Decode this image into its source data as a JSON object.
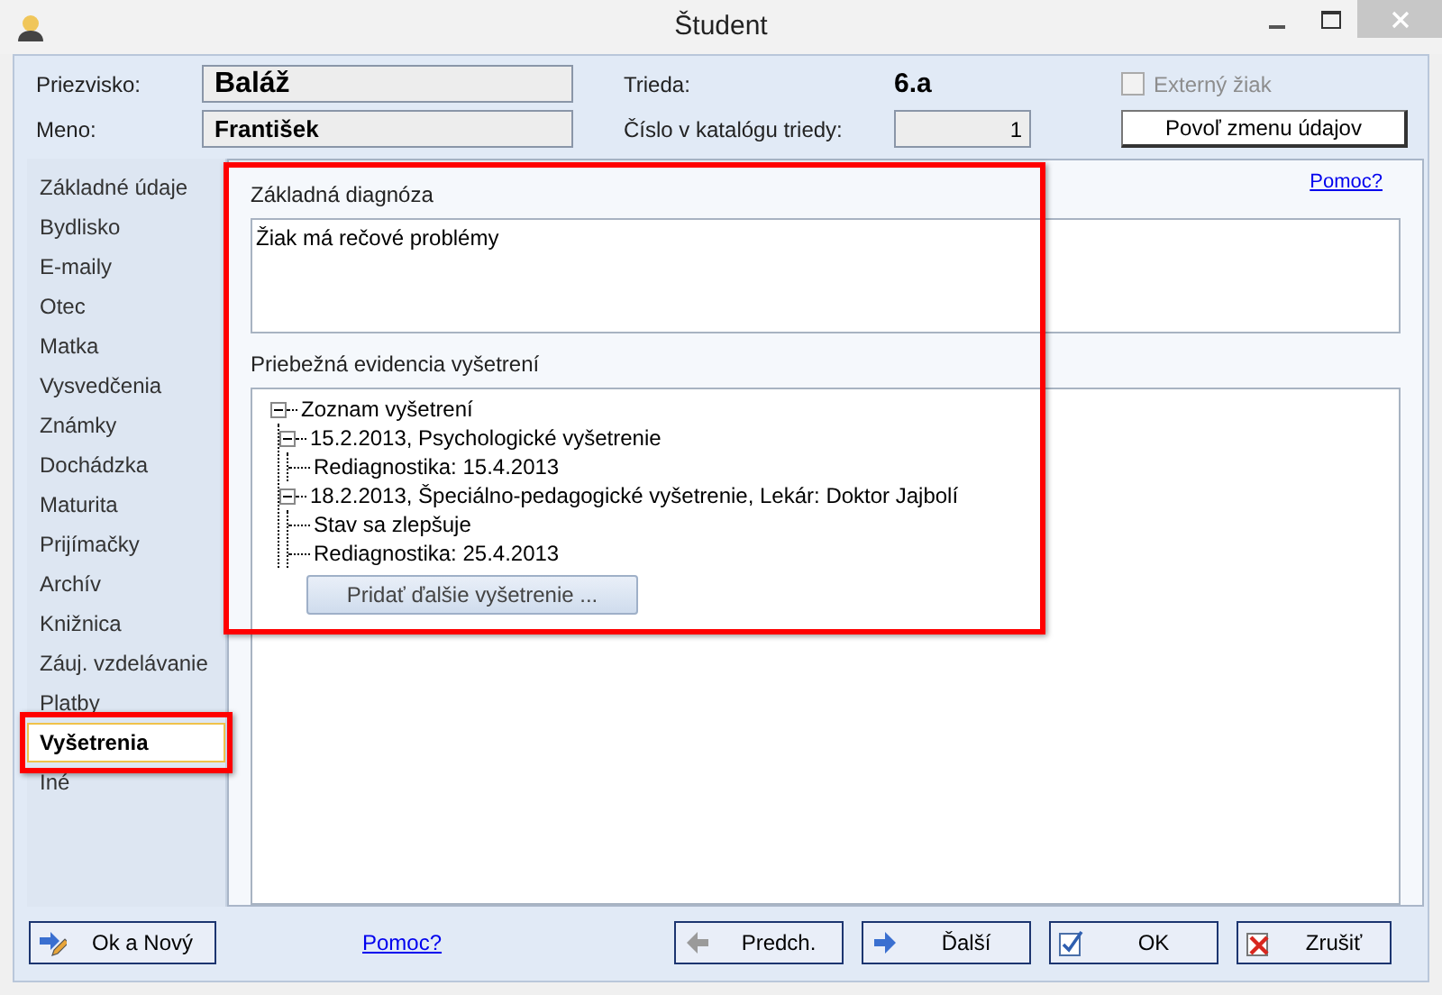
{
  "window": {
    "title": "Študent"
  },
  "header": {
    "fields": [
      {
        "label": "Priezvisko:",
        "value": "Baláž"
      },
      {
        "label": "Meno:",
        "value": "František"
      }
    ],
    "class_info": {
      "label": "Trieda:",
      "value": "6.a"
    },
    "catalog": {
      "label": "Číslo v katalógu triedy:",
      "value": "1"
    },
    "external": {
      "label": "Externý žiak",
      "checked": false,
      "disabled": true
    },
    "unlock_button": "Povoľ zmenu údajov"
  },
  "sidebar": {
    "items": [
      {
        "label": "Základné údaje",
        "selected": false
      },
      {
        "label": "Bydlisko",
        "selected": false
      },
      {
        "label": "E-maily",
        "selected": false
      },
      {
        "label": "Otec",
        "selected": false
      },
      {
        "label": "Matka",
        "selected": false
      },
      {
        "label": "Vysvedčenia",
        "selected": false
      },
      {
        "label": "Známky",
        "selected": false
      },
      {
        "label": "Dochádzka",
        "selected": false
      },
      {
        "label": "Maturita",
        "selected": false
      },
      {
        "label": "Prijímačky",
        "selected": false
      },
      {
        "label": "Archív",
        "selected": false
      },
      {
        "label": "Knižnica",
        "selected": false
      },
      {
        "label": "Záuj. vzdelávanie",
        "selected": false
      },
      {
        "label": "Platby",
        "selected": false
      },
      {
        "label": "Vyšetrenia",
        "selected": true
      },
      {
        "label": "Iné",
        "selected": false
      }
    ]
  },
  "content": {
    "help_link": "Pomoc?",
    "diagnosis": {
      "label": "Základná diagnóza",
      "value": "Žiak má rečové problémy"
    },
    "exams": {
      "label": "Priebežná evidencia vyšetrení",
      "tree": [
        {
          "label": "Zoznam vyšetrení",
          "expanded": true,
          "children": [
            {
              "label": "15.2.2013, Psychologické vyšetrenie",
              "expanded": true,
              "children": [
                {
                  "label": "Rediagnostika: 15.4.2013"
                }
              ]
            },
            {
              "label": "18.2.2013, Špeciálno-pedagogické vyšetrenie, Lekár: Doktor Jajbolí",
              "expanded": true,
              "children": [
                {
                  "label": "Stav sa zlepšuje"
                },
                {
                  "label": "Rediagnostika: 25.4.2013"
                }
              ]
            }
          ]
        }
      ],
      "add_button": "Pridať ďalšie vyšetrenie ..."
    }
  },
  "footer": {
    "left_button": {
      "label": "Ok a Nový",
      "kind": "save-new"
    },
    "help_link": "Pomoc?",
    "buttons": [
      {
        "label": "Predch.",
        "kind": "prev"
      },
      {
        "label": "Ďalší",
        "kind": "next"
      },
      {
        "label": "OK",
        "kind": "ok"
      },
      {
        "label": "Zrušiť",
        "kind": "cancel"
      }
    ]
  }
}
